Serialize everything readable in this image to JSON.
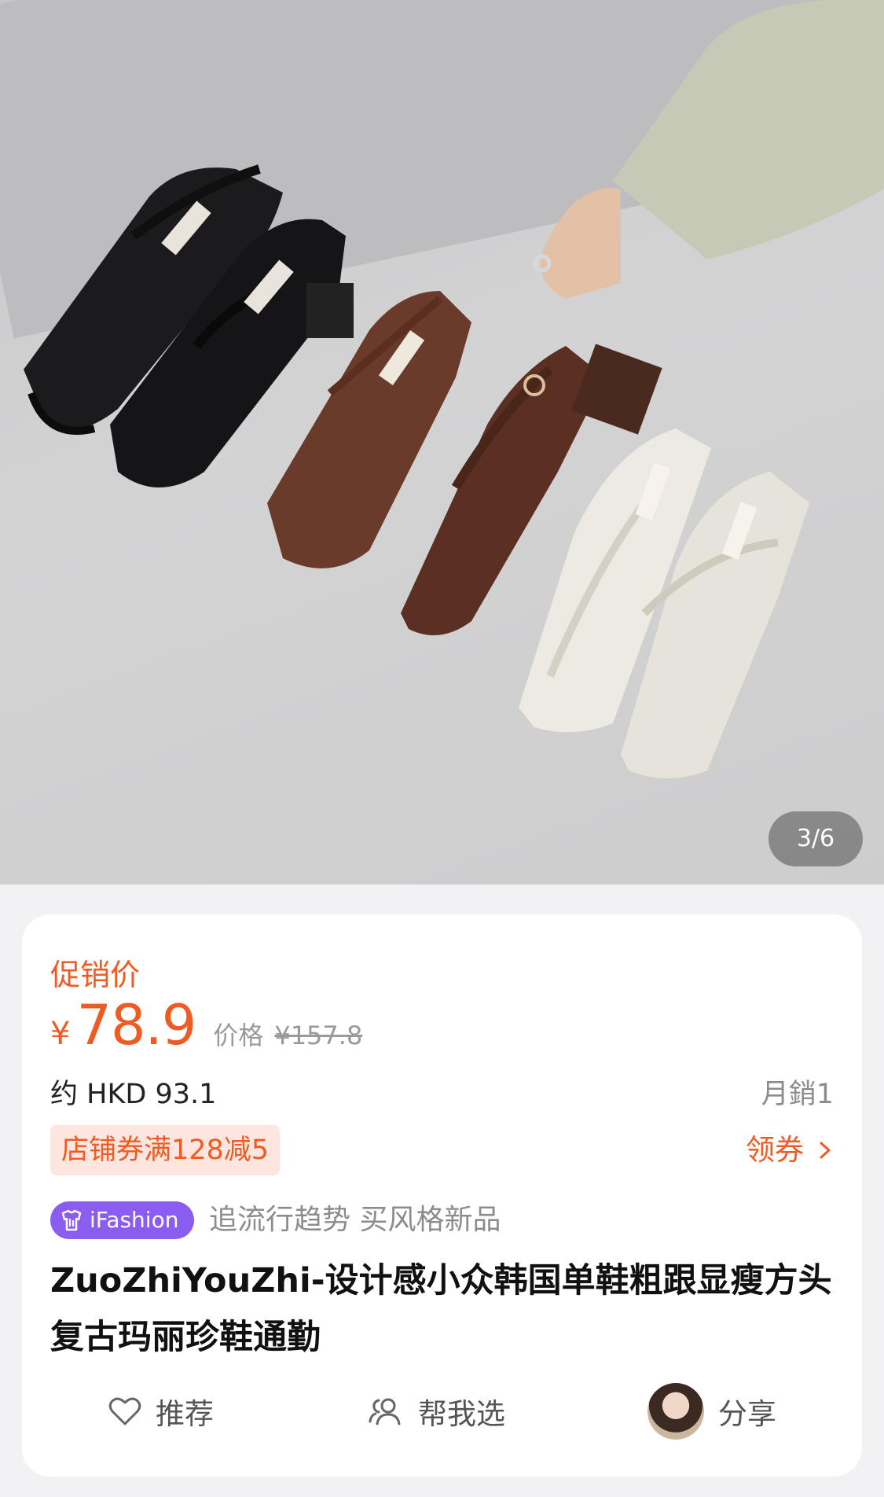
{
  "image": {
    "alt": "four pairs of square-toe Mary Jane shoes",
    "counter": "3/6"
  },
  "price": {
    "promo_label": "促销价",
    "currency": "¥",
    "current": "78.9",
    "original_label": "价格",
    "original": "¥157.8",
    "converted": "约 HKD 93.1",
    "monthly_sales": "月銷1"
  },
  "coupon": {
    "tag": "店铺券满128减5",
    "action": "领券"
  },
  "badge": {
    "label": "iFashion",
    "slogan": "追流行趋势 买风格新品"
  },
  "product": {
    "title": "ZuoZhiYouZhi-设计感小众韩国单鞋粗跟显瘦方头复古玛丽珍鞋通勤"
  },
  "actions": {
    "recommend": "推荐",
    "help_choose": "帮我选",
    "share": "分享"
  },
  "colors": {
    "accent": "#f05a23",
    "badge": "#8a5cf0",
    "card": "#ffffff",
    "background": "#f2f2f4"
  }
}
